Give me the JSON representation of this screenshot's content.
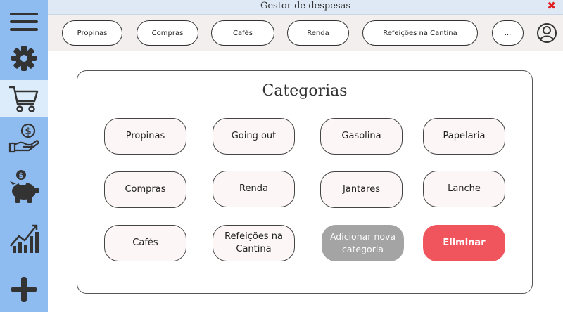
{
  "window": {
    "title": "Gestor de despesas",
    "close_symbol": "✖"
  },
  "sidebar": {
    "items": [
      {
        "id": "menu",
        "icon": "hamburger-menu-icon"
      },
      {
        "id": "settings",
        "icon": "gear-icon"
      },
      {
        "id": "shopping",
        "icon": "shopping-cart-icon",
        "active": true
      },
      {
        "id": "income",
        "icon": "hand-money-icon"
      },
      {
        "id": "savings",
        "icon": "piggy-bank-icon"
      },
      {
        "id": "stats",
        "icon": "bar-chart-icon"
      },
      {
        "id": "add",
        "icon": "plus-icon"
      }
    ],
    "colors": {
      "background": "#8fbcf0",
      "active": "#dcecfb",
      "icon": "#333333"
    }
  },
  "topbar": {
    "chips": [
      "Propinas",
      "Compras",
      "Cafés",
      "Renda",
      "Refeições na Cantina",
      "..."
    ],
    "profile_icon": "user-profile-icon"
  },
  "categories": {
    "title": "Categorias",
    "items": [
      "Propinas",
      "Going out",
      "Gasolina",
      "Papelaria",
      "Compras",
      "Renda",
      "Jantares",
      "Lanche",
      "Cafés",
      "Refeições na Cantina"
    ],
    "add_button": "Adicionar nova categoria",
    "delete_button": "Eliminar"
  },
  "colors": {
    "delete": "#f0545d",
    "add": "#a4a4a4",
    "category_bg": "#fcf7f6"
  }
}
